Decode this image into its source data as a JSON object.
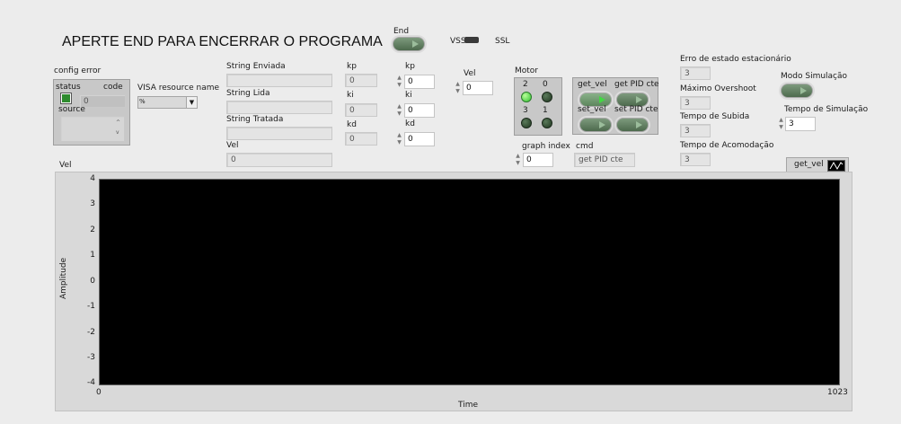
{
  "title": "APERTE END PARA ENCERRAR O PROGRAMA",
  "end_button": {
    "label": "End"
  },
  "vss_ssl": {
    "left": "VSS",
    "right": "SSL"
  },
  "config_error": {
    "label": "config error",
    "status_label": "status",
    "code_label": "code",
    "code_value": "0",
    "source_label": "source"
  },
  "visa": {
    "label": "VISA resource name",
    "prefix": "%"
  },
  "strings": {
    "enviada": "String Enviada",
    "lida": "String Lida",
    "tratada": "String Tratada",
    "vel_label": "Vel",
    "vel_value": "0"
  },
  "gains_ind": {
    "kp_label": "kp",
    "kp_value": "0",
    "ki_label": "ki",
    "ki_value": "0",
    "kd_label": "kd",
    "kd_value": "0"
  },
  "gains_ctrl": {
    "kp_label": "kp",
    "kp_value": "0",
    "ki_label": "ki",
    "ki_value": "0",
    "kd_label": "kd",
    "kd_value": "0"
  },
  "vel_ctrl": {
    "label": "Vel",
    "value": "0"
  },
  "motor": {
    "label": "Motor",
    "leds": [
      {
        "label": "2",
        "on": true
      },
      {
        "label": "0",
        "on": false
      },
      {
        "label": "3",
        "on": false
      },
      {
        "label": "1",
        "on": false
      }
    ]
  },
  "graph_index": {
    "label": "graph index",
    "value": "0"
  },
  "buttons": {
    "get_vel": "get_vel",
    "get_pid": "get PID cte",
    "set_vel": "set_vel",
    "set_pid": "set PID cte"
  },
  "cmd": {
    "label": "cmd",
    "value": "get PID cte"
  },
  "metrics": {
    "erro_label": "Erro de estado estacionário",
    "erro_value": "3",
    "overshoot_label": "Máximo Overshoot",
    "overshoot_value": "3",
    "subida_label": "Tempo de Subida",
    "subida_value": "3",
    "acomodacao_label": "Tempo de Acomodação",
    "acomodacao_value": "3"
  },
  "simulacao": {
    "modo_label": "Modo Simulação",
    "tempo_label": "Tempo de Simulação",
    "tempo_value": "3"
  },
  "graph": {
    "label": "Vel",
    "plot_legend": "get_vel",
    "ylabel": "Amplitude",
    "xlabel": "Time",
    "y_ticks": [
      "4",
      "3",
      "2",
      "1",
      "0",
      "-1",
      "-2",
      "-3",
      "-4"
    ],
    "x_min": "0",
    "x_max": "1023",
    "ylim": [
      -4,
      4
    ],
    "xlim": [
      0,
      1023
    ]
  }
}
